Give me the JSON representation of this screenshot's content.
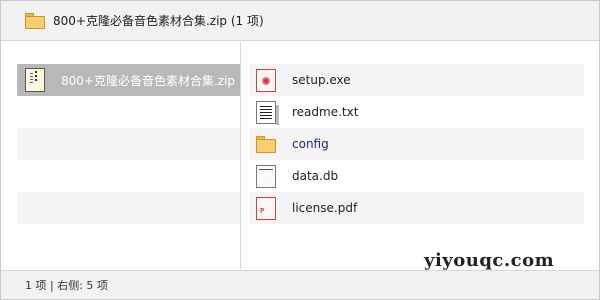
{
  "window": {
    "title": "800+克隆必备音色素材合集.zip (1 项)",
    "title_icon": "folder-icon"
  },
  "left_pane": {
    "items": [
      {
        "label": "800+克隆必备音色素材合集.zip",
        "icon": "zip-archive-icon",
        "selected": true
      }
    ]
  },
  "right_pane": {
    "files": [
      {
        "name": "setup.exe",
        "icon": "executable-icon",
        "type": "file"
      },
      {
        "name": "readme.txt",
        "icon": "text-file-icon",
        "type": "file"
      },
      {
        "name": "config",
        "icon": "folder-icon",
        "type": "folder"
      },
      {
        "name": "data.db",
        "icon": "database-file-icon",
        "type": "file"
      },
      {
        "name": "license.pdf",
        "icon": "pdf-file-icon",
        "type": "file"
      }
    ]
  },
  "statusbar": {
    "text": "1 项 | 右侧: 5 项"
  },
  "watermark": {
    "text": "yiyouqc.com"
  },
  "colors": {
    "selection": "#b8b8b8",
    "stripe": "#f4f4f4",
    "folder": "#f7cf6e",
    "folder_link_text": "#1a2a8a"
  }
}
